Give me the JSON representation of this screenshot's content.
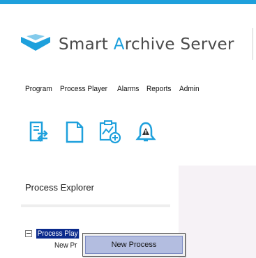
{
  "app": {
    "title_lead": "Smart ",
    "title_accent": "A",
    "title_tail": "rchive Server",
    "brand_color": "#1ea0dc",
    "logo_icon": "chevron-logo-icon"
  },
  "menubar": {
    "items": [
      {
        "label": "Program"
      },
      {
        "label": "Process Player"
      },
      {
        "label": "Alarms"
      },
      {
        "label": "Reports"
      },
      {
        "label": "Admin"
      }
    ]
  },
  "toolbar": {
    "tools": [
      {
        "icon": "import-export-icon"
      },
      {
        "icon": "new-document-icon"
      },
      {
        "icon": "add-chart-icon"
      },
      {
        "icon": "alarm-bell-icon"
      }
    ],
    "icon_color": "#1ea0dc",
    "alert_color": "#333333"
  },
  "process_explorer": {
    "title": "Process Explorer",
    "tree": {
      "root_label": "Process Play",
      "child_label": "New Pr"
    }
  },
  "context_menu": {
    "items": [
      {
        "label": "New Process",
        "highlighted": true
      }
    ]
  }
}
